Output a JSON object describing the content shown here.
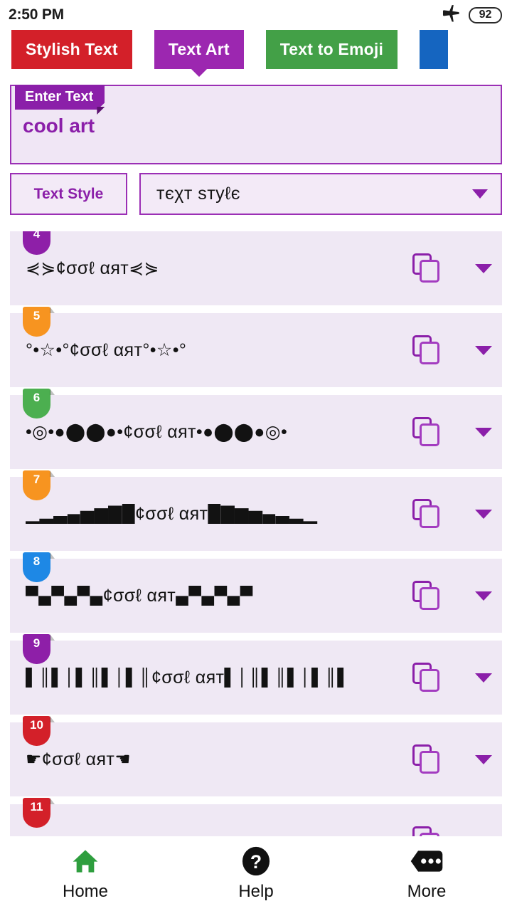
{
  "statusbar": {
    "time": "2:50 PM",
    "airplane_icon": "airplane-mode-icon",
    "battery_level": "92"
  },
  "tabs": [
    {
      "label": "Stylish Text",
      "color": "#d32029",
      "active": false
    },
    {
      "label": "Text Art",
      "color": "#9c27b0",
      "active": true
    },
    {
      "label": "Text to Emoji",
      "color": "#43a047",
      "active": false
    },
    {
      "label": "",
      "color": "#1565c0",
      "active": false
    }
  ],
  "enter_text": {
    "ribbon_label": "Enter Text",
    "value": "cool art",
    "placeholder": "Enter Text"
  },
  "text_style": {
    "label": "Text Style",
    "selected": "тєχт sтyℓє",
    "caret_icon": "chevron-down-icon"
  },
  "results": [
    {
      "number": "4",
      "badge_color": "#8e1fa8",
      "art": "⋞⋟¢σσℓ αят⋞⋟"
    },
    {
      "number": "5",
      "badge_color": "#f79420",
      "art": "°•☆•°¢σσℓ αят°•☆•°"
    },
    {
      "number": "6",
      "badge_color": "#4caf50",
      "art": "•◎•●⬤⬤●•¢σσℓ αят•●⬤⬤●◎•"
    },
    {
      "number": "7",
      "badge_color": "#f79420",
      "art": "▁▂▃▄▅▆▇█¢σσℓ αят█▇▆▅▄▃▂▁"
    },
    {
      "number": "8",
      "badge_color": "#1e88e5",
      "art": "▀▄▀▄▀▄¢σσℓ αят▄▀▄▀▄▀"
    },
    {
      "number": "9",
      "badge_color": "#8e1fa8",
      "art": "▌║▌│▌║▌│▌║¢σσℓ αят▌│║▌║▌│▌║▌"
    },
    {
      "number": "10",
      "badge_color": "#d32029",
      "art": "☛¢σσℓ αят☚"
    },
    {
      "number": "11",
      "badge_color": "#d32029",
      "art": ""
    }
  ],
  "row_actions": {
    "copy_icon": "copy-icon",
    "expand_icon": "chevron-down-icon"
  },
  "bottomnav": [
    {
      "label": "Home",
      "icon": "home-icon"
    },
    {
      "label": "Help",
      "icon": "help-circle-icon"
    },
    {
      "label": "More",
      "icon": "more-dots-icon"
    }
  ]
}
